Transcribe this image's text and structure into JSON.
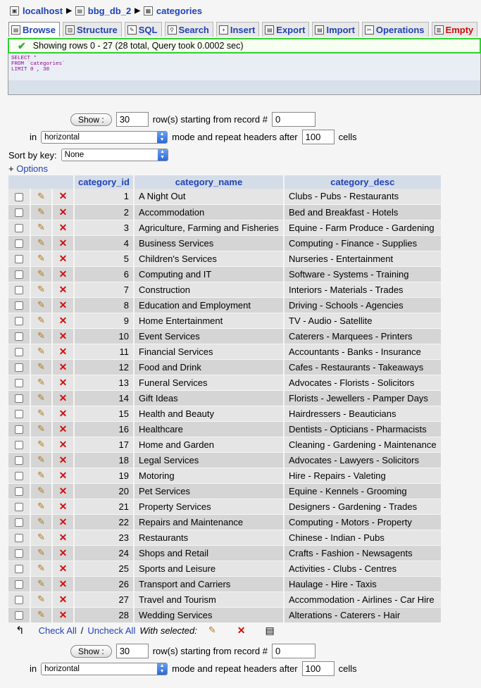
{
  "breadcrumb": {
    "server": "localhost",
    "database": "bbg_db_2",
    "table": "categories"
  },
  "tabs": [
    {
      "label": "Browse",
      "icon": "browse-icon"
    },
    {
      "label": "Structure",
      "icon": "structure-icon"
    },
    {
      "label": "SQL",
      "icon": "sql-icon"
    },
    {
      "label": "Search",
      "icon": "search-icon"
    },
    {
      "label": "Insert",
      "icon": "insert-icon"
    },
    {
      "label": "Export",
      "icon": "export-icon"
    },
    {
      "label": "Import",
      "icon": "import-icon"
    },
    {
      "label": "Operations",
      "icon": "operations-icon"
    },
    {
      "label": "Empty",
      "icon": "empty-icon"
    }
  ],
  "notice": "Showing rows 0 - 27 (28 total, Query took 0.0002 sec)",
  "query": {
    "line1": "SELECT *",
    "line2": "FROM `categories`",
    "line3": "LIMIT 0 , 30"
  },
  "nav": {
    "show_label": "Show :",
    "rows": "30",
    "rows_text": "row(s) starting from record #",
    "start": "0",
    "in_label": "in",
    "mode": "horizontal",
    "repeat_text": "mode and repeat headers after",
    "repeat": "100",
    "cells_text": "cells"
  },
  "sort": {
    "label": "Sort by key:",
    "value": "None"
  },
  "options_label": "Options",
  "columns": [
    "category_id",
    "category_name",
    "category_desc"
  ],
  "rows": [
    [
      "1",
      "A Night Out",
      "Clubs - Pubs - Restaurants"
    ],
    [
      "2",
      "Accommodation",
      "Bed and Breakfast - Hotels"
    ],
    [
      "3",
      "Agriculture, Farming and Fisheries",
      "Equine - Farm Produce - Gardening"
    ],
    [
      "4",
      "Business Services",
      "Computing - Finance - Supplies"
    ],
    [
      "5",
      "Children's Services",
      "Nurseries - Entertainment"
    ],
    [
      "6",
      "Computing and IT",
      "Software - Systems - Training"
    ],
    [
      "7",
      "Construction",
      "Interiors - Materials - Trades"
    ],
    [
      "8",
      "Education and Employment",
      "Driving - Schools - Agencies"
    ],
    [
      "9",
      "Home Entertainment",
      "TV - Audio - Satellite"
    ],
    [
      "10",
      "Event Services",
      "Caterers - Marquees - Printers"
    ],
    [
      "11",
      "Financial Services",
      "Accountants - Banks - Insurance"
    ],
    [
      "12",
      "Food and Drink",
      "Cafes - Restaurants - Takeaways"
    ],
    [
      "13",
      "Funeral Services",
      "Advocates - Florists - Solicitors"
    ],
    [
      "14",
      "Gift Ideas",
      "Florists - Jewellers - Pamper Days"
    ],
    [
      "15",
      "Health and Beauty",
      "Hairdressers - Beauticians"
    ],
    [
      "16",
      "Healthcare",
      "Dentists - Opticians - Pharmacists"
    ],
    [
      "17",
      "Home and Garden",
      "Cleaning - Gardening - Maintenance"
    ],
    [
      "18",
      "Legal Services",
      "Advocates - Lawyers - Solicitors"
    ],
    [
      "19",
      "Motoring",
      "Hire - Repairs - Valeting"
    ],
    [
      "20",
      "Pet Services",
      "Equine - Kennels - Grooming"
    ],
    [
      "21",
      "Property Services",
      "Designers - Gardening - Trades"
    ],
    [
      "22",
      "Repairs and Maintenance",
      "Computing - Motors - Property"
    ],
    [
      "23",
      "Restaurants",
      "Chinese - Indian - Pubs"
    ],
    [
      "24",
      "Shops and Retail",
      "Crafts - Fashion - Newsagents"
    ],
    [
      "25",
      "Sports and Leisure",
      "Activities - Clubs - Centres"
    ],
    [
      "26",
      "Transport and Carriers",
      "Haulage - Hire - Taxis"
    ],
    [
      "27",
      "Travel and Tourism",
      "Accommodation - Airlines - Car Hire"
    ],
    [
      "28",
      "Wedding Services",
      "Alterations - Caterers - Hair"
    ]
  ],
  "footer": {
    "check_all": "Check All",
    "sep": "/",
    "uncheck_all": "Uncheck All",
    "with_selected": "With selected:"
  }
}
